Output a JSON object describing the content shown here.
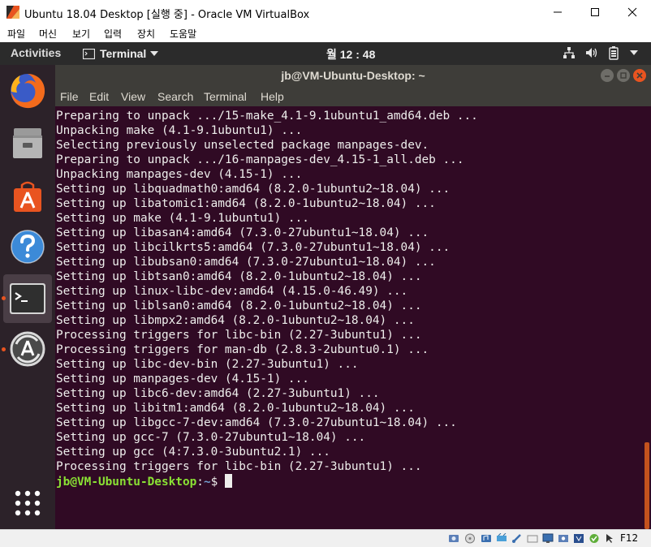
{
  "host_window": {
    "title": "Ubuntu 18.04 Desktop [실행 중] - Oracle VM VirtualBox",
    "menu": [
      "파일",
      "머신",
      "보기",
      "입력",
      "장치",
      "도움말"
    ],
    "host_key": "F12"
  },
  "ubuntu_topbar": {
    "activities": "Activities",
    "app_menu": "Terminal",
    "clock": "월 12 : 48"
  },
  "dock": {
    "items": [
      {
        "name": "Firefox",
        "icon": "firefox-icon",
        "running": false
      },
      {
        "name": "Files",
        "icon": "files-icon",
        "running": false
      },
      {
        "name": "Ubuntu Software",
        "icon": "software-icon",
        "running": false
      },
      {
        "name": "Help",
        "icon": "help-icon",
        "running": false
      },
      {
        "name": "Terminal",
        "icon": "terminal-icon",
        "running": true
      },
      {
        "name": "Software Updater",
        "icon": "updater-icon",
        "running": true
      },
      {
        "name": "Show Applications",
        "icon": "app-grid-icon",
        "running": false
      }
    ]
  },
  "terminal": {
    "title": "jb@VM-Ubuntu-Desktop: ~",
    "menu": [
      "File",
      "Edit",
      "View",
      "Search",
      "Terminal",
      "Help"
    ],
    "lines": [
      "Preparing to unpack .../15-make_4.1-9.1ubuntu1_amd64.deb ...",
      "Unpacking make (4.1-9.1ubuntu1) ...",
      "Selecting previously unselected package manpages-dev.",
      "Preparing to unpack .../16-manpages-dev_4.15-1_all.deb ...",
      "Unpacking manpages-dev (4.15-1) ...",
      "Setting up libquadmath0:amd64 (8.2.0-1ubuntu2~18.04) ...",
      "Setting up libatomic1:amd64 (8.2.0-1ubuntu2~18.04) ...",
      "Setting up make (4.1-9.1ubuntu1) ...",
      "Setting up libasan4:amd64 (7.3.0-27ubuntu1~18.04) ...",
      "Setting up libcilkrts5:amd64 (7.3.0-27ubuntu1~18.04) ...",
      "Setting up libubsan0:amd64 (7.3.0-27ubuntu1~18.04) ...",
      "Setting up libtsan0:amd64 (8.2.0-1ubuntu2~18.04) ...",
      "Setting up linux-libc-dev:amd64 (4.15.0-46.49) ...",
      "Setting up liblsan0:amd64 (8.2.0-1ubuntu2~18.04) ...",
      "Setting up libmpx2:amd64 (8.2.0-1ubuntu2~18.04) ...",
      "Processing triggers for libc-bin (2.27-3ubuntu1) ...",
      "Processing triggers for man-db (2.8.3-2ubuntu0.1) ...",
      "Setting up libc-dev-bin (2.27-3ubuntu1) ...",
      "Setting up manpages-dev (4.15-1) ...",
      "Setting up libc6-dev:amd64 (2.27-3ubuntu1) ...",
      "Setting up libitm1:amd64 (8.2.0-1ubuntu2~18.04) ...",
      "Setting up libgcc-7-dev:amd64 (7.3.0-27ubuntu1~18.04) ...",
      "Setting up gcc-7 (7.3.0-27ubuntu1~18.04) ...",
      "Setting up gcc (4:7.3.0-3ubuntu2.1) ...",
      "Processing triggers for libc-bin (2.27-3ubuntu1) ..."
    ],
    "prompt": {
      "user_host": "jb@VM-Ubuntu-Desktop",
      "separator": ":",
      "path": "~",
      "symbol": "$ "
    }
  },
  "colors": {
    "terminal_bg": "#300a24",
    "prompt_user": "#8ae234",
    "prompt_path": "#729fcf",
    "accent": "#e95420"
  }
}
